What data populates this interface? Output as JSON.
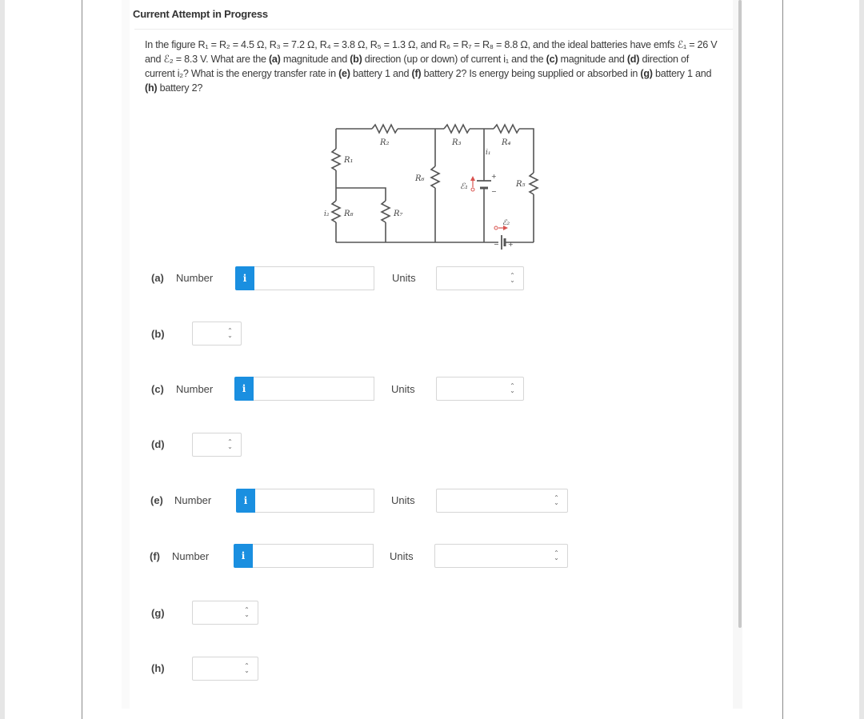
{
  "header": {
    "title": "Current Attempt in Progress"
  },
  "question": {
    "segments": [
      "In the figure R₁ = R₂ = 4.5 Ω, R₃ = 7.2 Ω, R₄ = 3.8 Ω, R₅ = 1.3 Ω, and R₆ = R₇ = R₈ = 8.8 Ω, and the ideal batteries have emfs ℰ₁ = 26 V and ℰ₂ = 8.3 V. What are the ",
      "(a)",
      " magnitude and ",
      "(b)",
      " direction (up or down) of current i₁ and the ",
      "(c)",
      " magnitude and ",
      "(d)",
      " direction of current i₂? What is the energy transfer rate in ",
      "(e)",
      " battery 1 and ",
      "(f)",
      " battery 2? Is energy being supplied or absorbed in ",
      "(g)",
      " battery 1 and ",
      "(h)",
      " battery 2?"
    ]
  },
  "figure": {
    "labels": {
      "r1": "R₁",
      "r2": "R₂",
      "r3": "R₃",
      "r4": "R₄",
      "r5": "R₅",
      "r6": "R₆",
      "r7": "R₇",
      "r8": "R₈",
      "i1": "i₁",
      "i2": "i₂",
      "emf1": "ℰ₁",
      "emf2": "ℰ₂",
      "plus": "+",
      "minus": "−"
    },
    "colors": {
      "wire": "#555555",
      "emf_marker": "#d9534f"
    }
  },
  "answers": {
    "number_label": "Number",
    "units_label": "Units",
    "info_glyph": "i",
    "rows": [
      {
        "id": "a",
        "label": "(a)",
        "type": "number",
        "value": "",
        "units": ""
      },
      {
        "id": "b",
        "label": "(b)",
        "type": "select",
        "value": ""
      },
      {
        "id": "c",
        "label": "(c)",
        "type": "number",
        "value": "",
        "units": ""
      },
      {
        "id": "d",
        "label": "(d)",
        "type": "select",
        "value": ""
      },
      {
        "id": "e",
        "label": "(e)",
        "type": "number",
        "value": "",
        "units": ""
      },
      {
        "id": "f",
        "label": "(f)",
        "type": "number",
        "value": "",
        "units": ""
      },
      {
        "id": "g",
        "label": "(g)",
        "type": "select",
        "value": ""
      },
      {
        "id": "h",
        "label": "(h)",
        "type": "select",
        "value": ""
      }
    ]
  },
  "theme": {
    "info_button_color": "#1a8fe0"
  }
}
